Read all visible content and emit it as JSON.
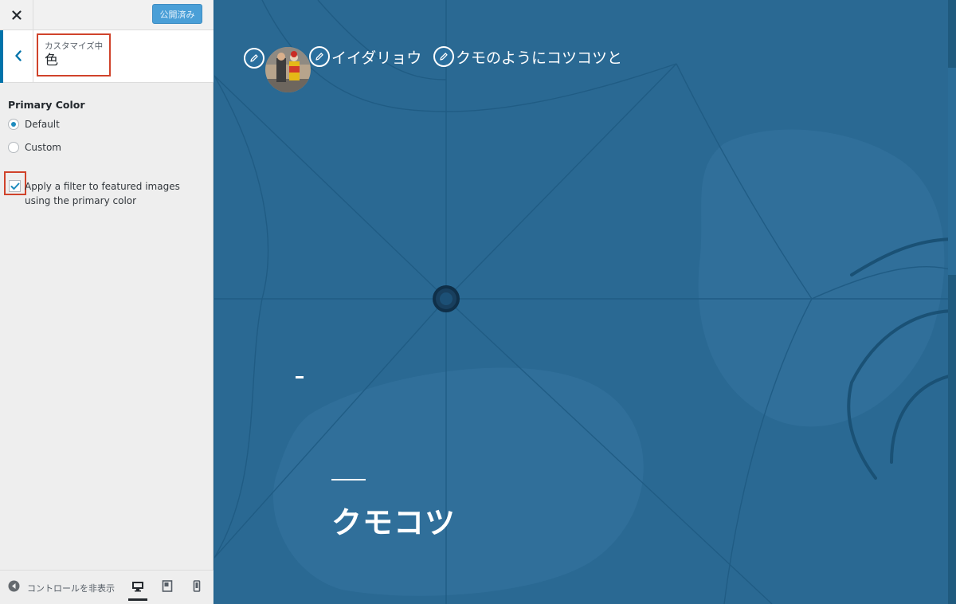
{
  "topbar": {
    "close_icon": "close-icon",
    "publish_label": "公開済み"
  },
  "section": {
    "back_icon": "chevron-left-icon",
    "customizing_label": "カスタマイズ中",
    "title": "色"
  },
  "controls": {
    "primary_color_heading": "Primary Color",
    "options": [
      {
        "label": "Default",
        "checked": true
      },
      {
        "label": "Custom",
        "checked": false
      }
    ],
    "filter_label": "Apply a filter to featured images using the primary color",
    "filter_checked": true
  },
  "footer": {
    "hide_controls_label": "コントロールを非表示",
    "devices": [
      "desktop-icon",
      "tablet-icon",
      "mobile-icon"
    ],
    "active_device": "desktop"
  },
  "preview": {
    "site_title": "イイダリョウ",
    "site_tagline": "クモのようにコツコツと",
    "post_title": "クモコツ",
    "edit_icon": "pencil-icon"
  },
  "colors": {
    "accent": "#0073aa",
    "publish_button": "#4a9fd7",
    "highlight_border": "#d0432b",
    "preview_background": "#2a6993"
  }
}
